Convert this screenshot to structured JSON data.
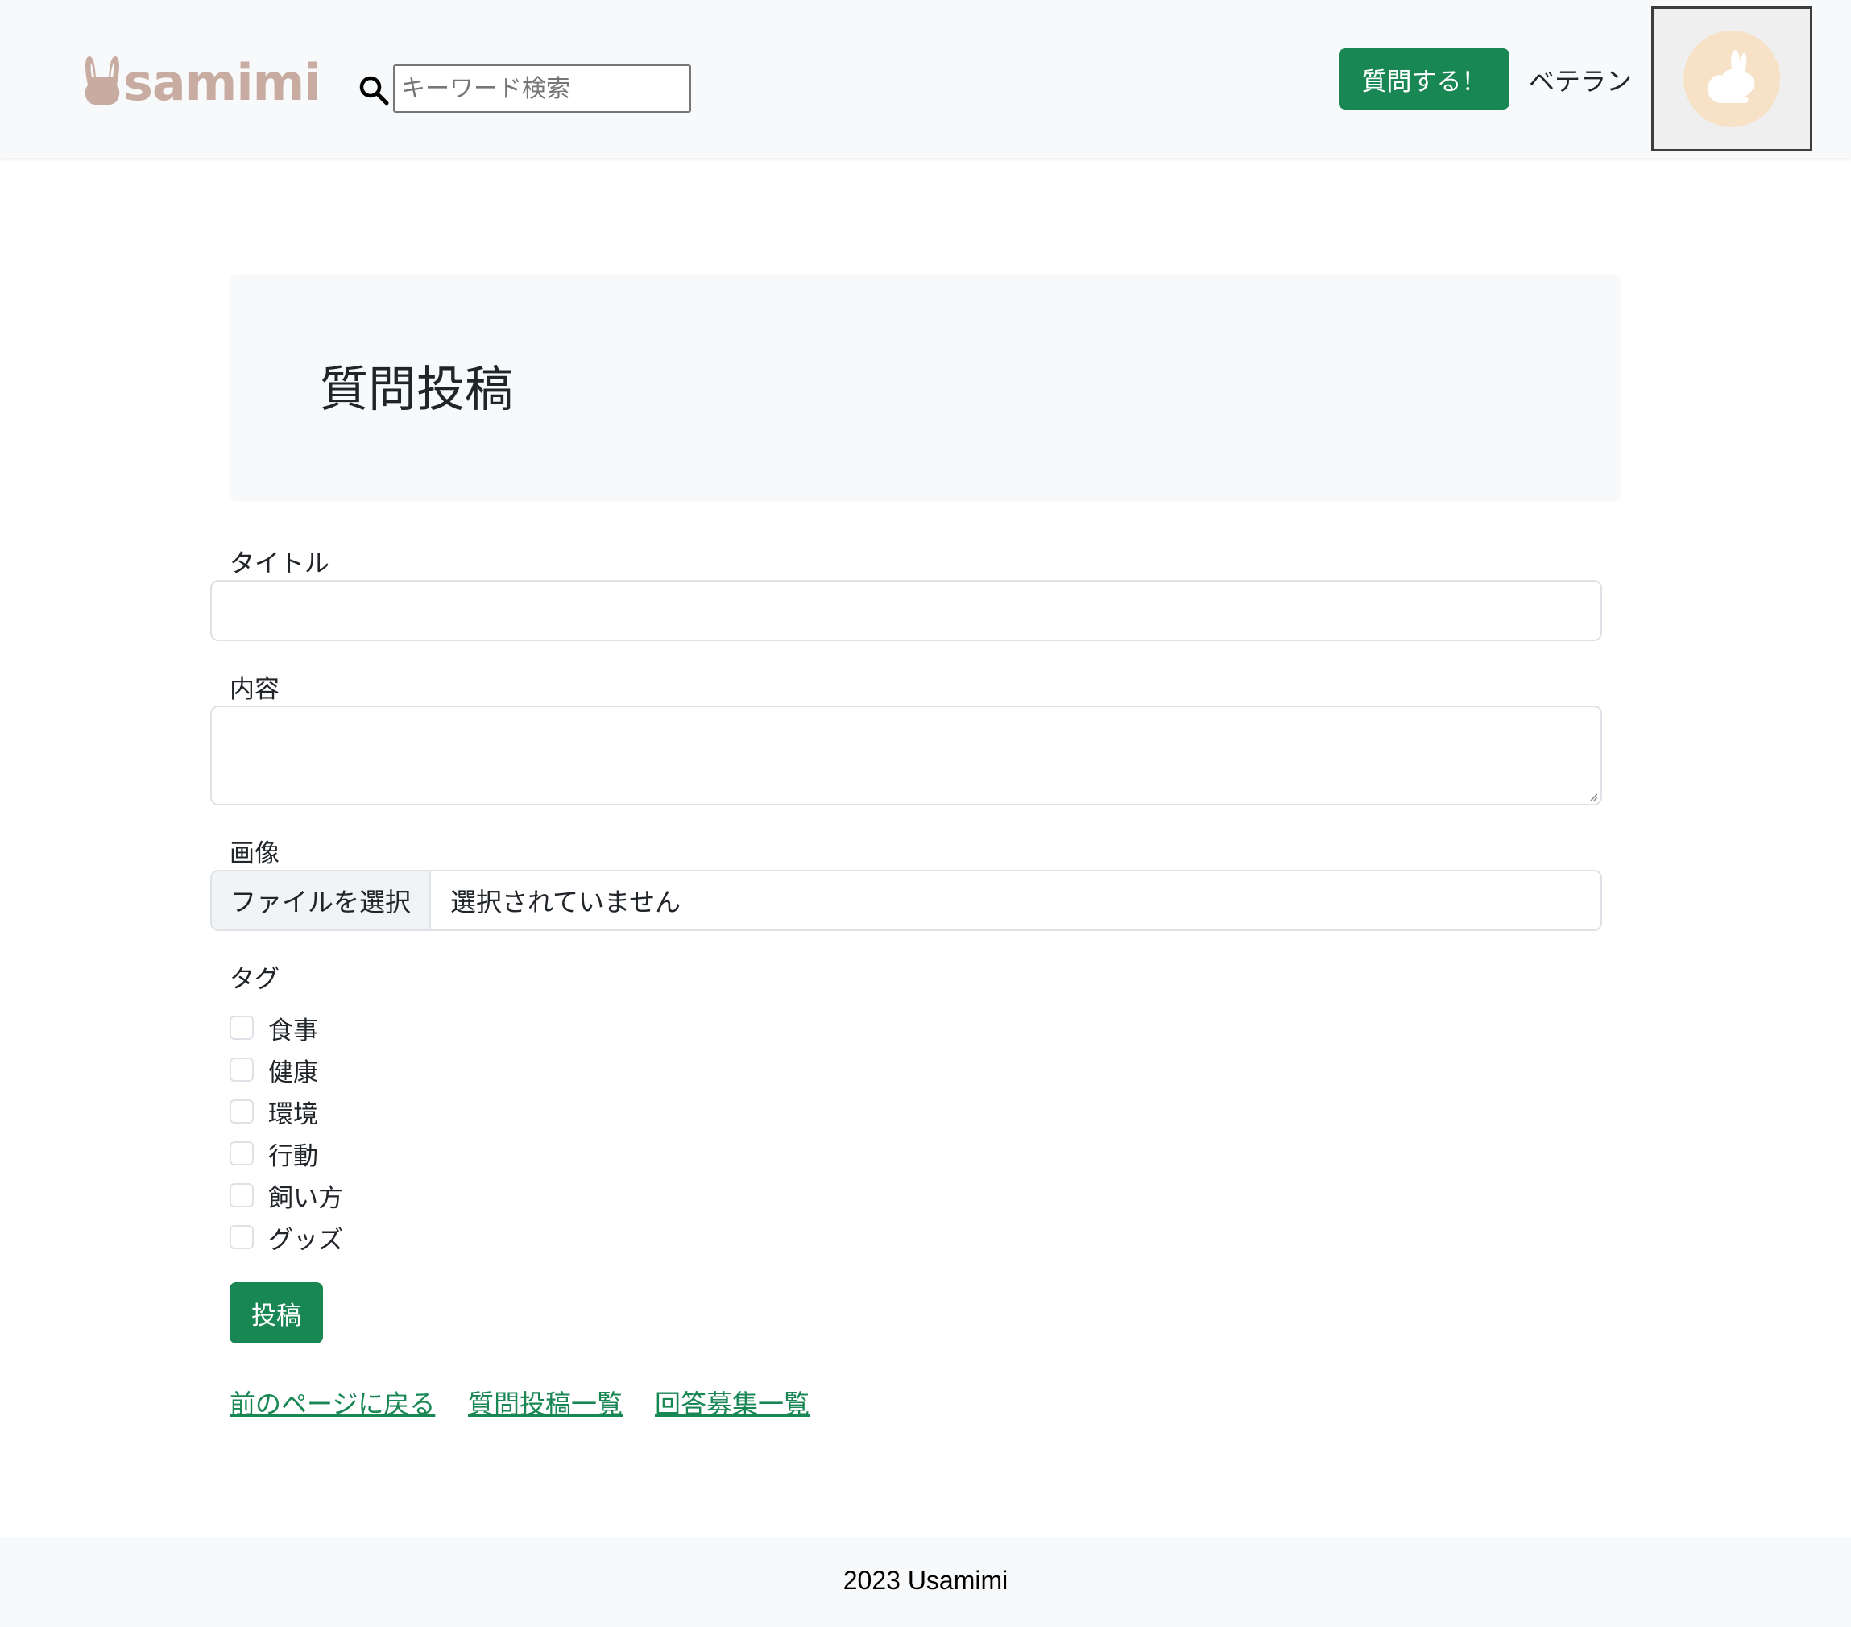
{
  "header": {
    "logo_text": "samimi",
    "search_placeholder": "キーワード検索",
    "ask_button_label": "質問する！",
    "username": "ベテラン"
  },
  "main": {
    "page_title": "質問投稿",
    "title_label": "タイトル",
    "content_label": "内容",
    "image_label": "画像",
    "file_button_label": "ファイルを選択",
    "file_status": "選択されていません",
    "tag_label": "タグ",
    "tags": [
      {
        "label": "食事",
        "checked": false
      },
      {
        "label": "健康",
        "checked": false
      },
      {
        "label": "環境",
        "checked": false
      },
      {
        "label": "行動",
        "checked": false
      },
      {
        "label": "飼い方",
        "checked": false
      },
      {
        "label": "グッズ",
        "checked": false
      }
    ],
    "submit_label": "投稿",
    "links": [
      "前のページに戻る",
      "質問投稿一覧",
      "回答募集一覧"
    ]
  },
  "footer": {
    "text": "2023 Usamimi"
  },
  "colors": {
    "accent": "#198754",
    "logo": "#c8aca1",
    "avatar_bg": "#f7e2c8"
  }
}
